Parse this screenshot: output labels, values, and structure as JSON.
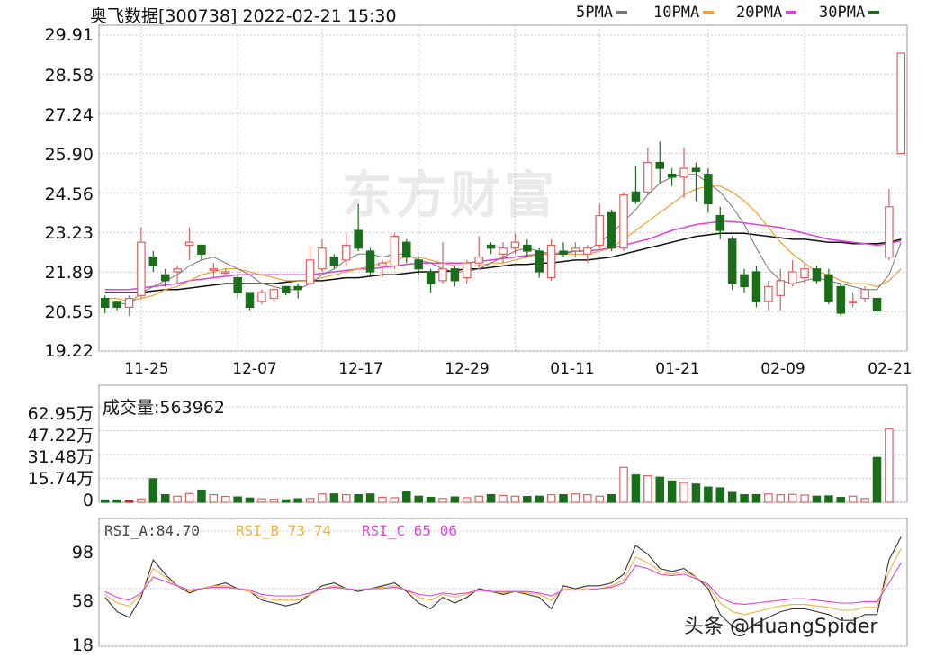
{
  "header": {
    "title": "奥飞数据[300738] 2022-02-21 15:30",
    "legend": [
      {
        "label": "5PMA",
        "color": "#777777"
      },
      {
        "label": "10PMA",
        "color": "#f0a030"
      },
      {
        "label": "20PMA",
        "color": "#e040e0"
      },
      {
        "label": "30PMA",
        "color": "#1a6e1a"
      }
    ]
  },
  "watermark_logo": "东方财富",
  "watermark_credit": "头条 @HuangSpider",
  "volume_label": "成交量:563962",
  "rsi_legend": [
    {
      "label": "RSI_A:84.70",
      "color": "#444444"
    },
    {
      "label": "RSI_B 73 74",
      "color": "#f0b040"
    },
    {
      "label": "RSI_C 65 06",
      "color": "#e040e0"
    }
  ],
  "colors": {
    "up": "#e06060",
    "down": "#1a6e1a",
    "grid": "#cccccc"
  },
  "chart_data": [
    {
      "type": "candlestick",
      "title": "奥飞数据[300738] 2022-02-21 15:30",
      "ylim": [
        19.22,
        29.91
      ],
      "y_ticks": [
        "29.91",
        "28.58",
        "27.24",
        "25.90",
        "24.56",
        "23.23",
        "21.89",
        "20.55",
        "19.22"
      ],
      "x_ticks": [
        "11-25",
        "12-07",
        "12-17",
        "12-29",
        "01-11",
        "01-21",
        "02-09",
        "02-21"
      ],
      "x_tick_index": [
        3,
        11,
        18,
        26,
        34,
        41,
        50,
        58
      ],
      "candles": [
        [
          21.0,
          20.7,
          21.1,
          20.5
        ],
        [
          20.9,
          20.7,
          20.9,
          20.6
        ],
        [
          20.7,
          21.0,
          21.1,
          20.4
        ],
        [
          21.1,
          22.9,
          23.4,
          21.0
        ],
        [
          22.4,
          22.1,
          22.6,
          21.9
        ],
        [
          21.8,
          21.6,
          22.0,
          21.4
        ],
        [
          21.9,
          22.0,
          22.1,
          21.5
        ],
        [
          22.8,
          22.9,
          23.4,
          22.3
        ],
        [
          22.8,
          22.5,
          22.8,
          22.3
        ],
        [
          22.0,
          22.0,
          22.2,
          21.7
        ],
        [
          21.9,
          21.9,
          22.0,
          21.8
        ],
        [
          21.7,
          21.2,
          21.8,
          21.0
        ],
        [
          21.2,
          20.7,
          21.2,
          20.6
        ],
        [
          20.9,
          21.2,
          21.3,
          20.8
        ],
        [
          21.0,
          21.3,
          21.4,
          20.9
        ],
        [
          21.4,
          21.2,
          21.4,
          21.1
        ],
        [
          21.4,
          21.3,
          21.5,
          21.0
        ],
        [
          21.5,
          22.3,
          22.8,
          21.5
        ],
        [
          22.0,
          22.7,
          23.0,
          21.9
        ],
        [
          22.4,
          22.1,
          22.5,
          22.0
        ],
        [
          22.3,
          22.8,
          23.2,
          22.1
        ],
        [
          23.3,
          22.7,
          24.2,
          22.6
        ],
        [
          22.6,
          21.9,
          22.7,
          21.8
        ],
        [
          22.1,
          22.2,
          22.3,
          21.7
        ],
        [
          22.1,
          23.1,
          23.2,
          22.0
        ],
        [
          22.9,
          22.4,
          23.0,
          22.2
        ],
        [
          22.3,
          22.0,
          22.4,
          21.8
        ],
        [
          21.9,
          21.5,
          22.0,
          21.2
        ],
        [
          21.6,
          22.0,
          22.9,
          21.5
        ],
        [
          22.0,
          21.6,
          22.1,
          21.4
        ],
        [
          21.7,
          22.2,
          22.3,
          21.5
        ],
        [
          22.2,
          22.4,
          23.1,
          22.0
        ],
        [
          22.8,
          22.7,
          22.9,
          22.5
        ],
        [
          22.5,
          22.7,
          22.9,
          22.2
        ],
        [
          22.7,
          22.9,
          23.2,
          22.5
        ],
        [
          22.8,
          22.6,
          23.0,
          22.4
        ],
        [
          22.6,
          21.9,
          22.7,
          21.7
        ],
        [
          21.7,
          22.8,
          23.0,
          21.6
        ],
        [
          22.6,
          22.5,
          22.9,
          22.4
        ],
        [
          22.6,
          22.7,
          22.9,
          22.4
        ],
        [
          22.5,
          22.7,
          22.8,
          22.2
        ],
        [
          22.8,
          23.8,
          24.2,
          22.7
        ],
        [
          23.9,
          22.7,
          24.0,
          22.6
        ],
        [
          22.7,
          24.5,
          24.6,
          22.6
        ],
        [
          24.6,
          24.3,
          25.5,
          24.2
        ],
        [
          24.6,
          25.6,
          26.1,
          24.5
        ],
        [
          25.6,
          25.4,
          26.3,
          24.9
        ],
        [
          25.2,
          25.1,
          25.4,
          24.8
        ],
        [
          25.1,
          25.4,
          26.1,
          24.4
        ],
        [
          25.4,
          25.3,
          25.6,
          24.3
        ],
        [
          25.2,
          24.2,
          25.4,
          23.9
        ],
        [
          23.8,
          23.3,
          24.1,
          23.0
        ],
        [
          23.0,
          21.5,
          23.1,
          21.3
        ],
        [
          21.8,
          21.4,
          22.0,
          21.2
        ],
        [
          21.9,
          20.9,
          22.1,
          20.7
        ],
        [
          20.9,
          21.4,
          21.6,
          20.6
        ],
        [
          21.1,
          21.6,
          22.0,
          20.6
        ],
        [
          21.5,
          21.9,
          22.3,
          21.4
        ],
        [
          21.7,
          22.0,
          22.2,
          21.5
        ],
        [
          22.0,
          21.6,
          22.1,
          21.5
        ],
        [
          21.8,
          20.9,
          22.0,
          20.8
        ],
        [
          21.4,
          20.5,
          21.5,
          20.4
        ],
        [
          20.9,
          20.9,
          21.2,
          20.7
        ],
        [
          21.0,
          21.3,
          21.4,
          20.9
        ],
        [
          21.0,
          20.6,
          21.0,
          20.5
        ],
        [
          22.4,
          24.1,
          24.7,
          22.3
        ],
        [
          25.9,
          29.3,
          29.3,
          25.9
        ]
      ],
      "ma5": [
        20.9,
        20.85,
        20.8,
        21.2,
        21.4,
        21.6,
        21.8,
        22.1,
        22.3,
        22.4,
        22.2,
        22.0,
        21.8,
        21.5,
        21.4,
        21.3,
        21.3,
        21.5,
        21.8,
        22.0,
        22.3,
        22.5,
        22.5,
        22.4,
        22.5,
        22.5,
        22.3,
        22.2,
        22.0,
        21.9,
        21.9,
        22.0,
        22.2,
        22.4,
        22.6,
        22.7,
        22.6,
        22.5,
        22.5,
        22.6,
        22.6,
        22.9,
        23.2,
        23.6,
        24.0,
        24.5,
        24.9,
        25.1,
        25.2,
        25.2,
        24.9,
        24.6,
        24.1,
        23.5,
        22.7,
        22.0,
        21.6,
        21.5,
        21.6,
        21.7,
        21.6,
        21.5,
        21.4,
        21.3,
        21.3,
        21.8,
        22.9
      ],
      "ma10": [
        21.0,
        21.0,
        20.9,
        21.0,
        21.1,
        21.3,
        21.4,
        21.6,
        21.8,
        21.9,
        22.0,
        22.0,
        21.9,
        21.8,
        21.7,
        21.6,
        21.6,
        21.6,
        21.7,
        21.8,
        21.9,
        22.0,
        22.1,
        22.2,
        22.3,
        22.4,
        22.4,
        22.3,
        22.2,
        22.1,
        22.1,
        22.1,
        22.2,
        22.2,
        22.3,
        22.4,
        22.5,
        22.5,
        22.5,
        22.5,
        22.5,
        22.6,
        22.7,
        23.0,
        23.3,
        23.6,
        23.9,
        24.2,
        24.5,
        24.7,
        24.8,
        24.8,
        24.6,
        24.3,
        23.9,
        23.4,
        22.9,
        22.5,
        22.2,
        21.9,
        21.8,
        21.6,
        21.5,
        21.5,
        21.4,
        21.6,
        22.0
      ],
      "ma20": [
        21.3,
        21.3,
        21.3,
        21.35,
        21.4,
        21.45,
        21.5,
        21.6,
        21.65,
        21.7,
        21.75,
        21.8,
        21.8,
        21.8,
        21.8,
        21.8,
        21.8,
        21.8,
        21.85,
        21.9,
        21.95,
        22.0,
        22.0,
        22.05,
        22.1,
        22.15,
        22.2,
        22.2,
        22.2,
        22.2,
        22.2,
        22.25,
        22.3,
        22.35,
        22.4,
        22.45,
        22.5,
        22.5,
        22.55,
        22.6,
        22.6,
        22.65,
        22.7,
        22.8,
        22.9,
        23.0,
        23.15,
        23.3,
        23.4,
        23.5,
        23.55,
        23.6,
        23.6,
        23.55,
        23.5,
        23.45,
        23.4,
        23.3,
        23.2,
        23.1,
        23.0,
        22.95,
        22.9,
        22.85,
        22.8,
        22.85,
        22.95
      ],
      "ma30": [
        21.2,
        21.2,
        21.2,
        21.2,
        21.25,
        21.3,
        21.3,
        21.35,
        21.4,
        21.45,
        21.5,
        21.5,
        21.5,
        21.5,
        21.5,
        21.55,
        21.6,
        21.6,
        21.6,
        21.65,
        21.7,
        21.7,
        21.75,
        21.8,
        21.8,
        21.85,
        21.9,
        21.9,
        21.9,
        21.95,
        22.0,
        22.0,
        22.05,
        22.1,
        22.15,
        22.15,
        22.2,
        22.2,
        22.25,
        22.3,
        22.3,
        22.35,
        22.4,
        22.5,
        22.6,
        22.7,
        22.8,
        22.9,
        23.0,
        23.1,
        23.15,
        23.2,
        23.2,
        23.2,
        23.15,
        23.1,
        23.05,
        23.0,
        23.0,
        22.95,
        22.9,
        22.9,
        22.85,
        22.85,
        22.85,
        22.9,
        23.0
      ]
    },
    {
      "type": "bar",
      "title": "成交量:563962",
      "ylim": [
        0,
        62.95
      ],
      "y_ticks": [
        "62.95万",
        "47.22万",
        "31.48万",
        "15.74万",
        "0"
      ],
      "values": [
        1.5,
        1.5,
        1.4,
        2.2,
        15.5,
        5.0,
        4.0,
        5.8,
        8.0,
        5.0,
        3.8,
        3.5,
        2.8,
        2.3,
        2.0,
        1.6,
        2.3,
        2.5,
        5.5,
        5.5,
        5.0,
        5.0,
        5.5,
        3.3,
        3.0,
        6.8,
        4.0,
        3.2,
        2.5,
        3.5,
        3.0,
        4.0,
        5.0,
        4.5,
        4.0,
        3.8,
        4.0,
        5.0,
        5.0,
        5.5,
        5.0,
        4.0,
        5.0,
        23.0,
        18.0,
        17.5,
        16.5,
        14.0,
        13.0,
        12.0,
        10.0,
        9.5,
        6.5,
        5.0,
        5.0,
        5.5,
        5.0,
        5.2,
        4.8,
        4.0,
        4.2,
        3.2,
        4.0,
        2.5,
        29.5,
        48.5
      ]
    },
    {
      "type": "line",
      "title": "",
      "ylim": [
        18,
        98
      ],
      "y_ticks": [
        "98",
        "58",
        "18"
      ],
      "series": [
        {
          "name": "RSI_A",
          "values": [
            52,
            42,
            38,
            52,
            78,
            68,
            60,
            55,
            58,
            60,
            62,
            58,
            56,
            50,
            48,
            46,
            48,
            54,
            60,
            62,
            58,
            56,
            58,
            60,
            62,
            56,
            48,
            44,
            52,
            48,
            52,
            58,
            56,
            54,
            56,
            54,
            52,
            44,
            60,
            58,
            60,
            60,
            62,
            68,
            88,
            82,
            72,
            70,
            72,
            66,
            58,
            40,
            32,
            28,
            34,
            38,
            42,
            44,
            44,
            42,
            40,
            36,
            36,
            40,
            40,
            78,
            94
          ]
        },
        {
          "name": "RSI_B",
          "values": [
            54,
            48,
            46,
            54,
            72,
            66,
            60,
            56,
            58,
            60,
            60,
            58,
            56,
            52,
            50,
            50,
            50,
            54,
            58,
            60,
            58,
            57,
            58,
            59,
            60,
            57,
            52,
            50,
            54,
            52,
            54,
            57,
            56,
            55,
            56,
            55,
            54,
            50,
            58,
            57,
            58,
            58,
            60,
            64,
            80,
            76,
            70,
            68,
            70,
            66,
            60,
            48,
            42,
            40,
            42,
            44,
            46,
            47,
            47,
            46,
            45,
            43,
            43,
            45,
            45,
            70,
            86
          ]
        },
        {
          "name": "RSI_C",
          "values": [
            56,
            52,
            50,
            55,
            66,
            63,
            60,
            57,
            58,
            59,
            59,
            58,
            57,
            54,
            53,
            53,
            53,
            55,
            58,
            59,
            58,
            57,
            58,
            58,
            59,
            57,
            54,
            53,
            55,
            54,
            55,
            57,
            56,
            56,
            56,
            56,
            55,
            53,
            57,
            57,
            57,
            58,
            59,
            62,
            74,
            72,
            68,
            67,
            68,
            65,
            61,
            52,
            48,
            47,
            48,
            49,
            50,
            51,
            51,
            50,
            49,
            48,
            48,
            49,
            49,
            62,
            76
          ]
        }
      ]
    }
  ]
}
